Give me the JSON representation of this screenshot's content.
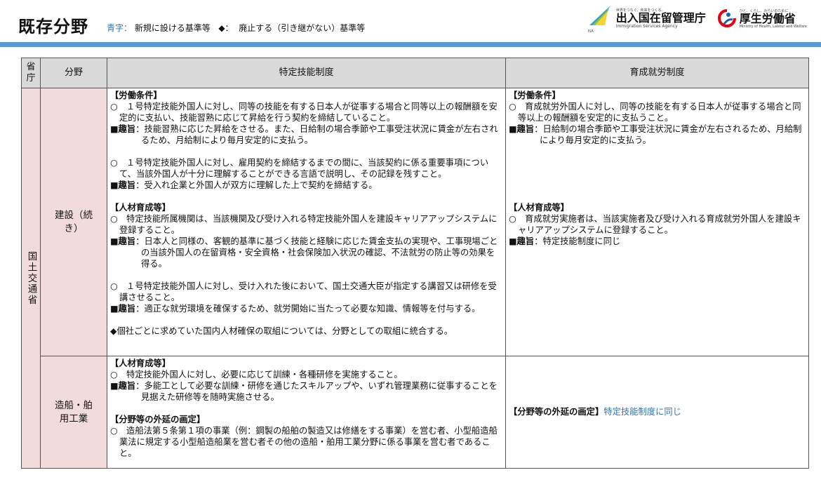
{
  "header": {
    "title": "既存分野",
    "legend_blue_label": "青字：",
    "legend_blue_text": "新規に設ける基準等",
    "legend_diamond_label": "◆：",
    "legend_diamond_text": "廃止する（引き継がない）基準等"
  },
  "logos": {
    "isa_tagline": "世界をつなぐ、未来をつくる。",
    "isa_name": "出入国在留管理庁",
    "isa_en": "Immigration Services Agency",
    "isa_abbr": "ISA",
    "mhlw_tagline": "ひと、くらし、みらいのために",
    "mhlw_name": "厚生労働省",
    "mhlw_en": "Ministry of Health, Labour and Welfare"
  },
  "table": {
    "headers": [
      "省庁",
      "分野",
      "特定技能制度",
      "育成就労制度"
    ],
    "ministry": "国土交通省",
    "rows": [
      {
        "field": "建設（続き）",
        "tokutei": [
          {
            "t": "h",
            "text": "【労働条件】"
          },
          {
            "t": "c",
            "text": "○　１号特定技能外国人に対し、同等の技能を有する日本人が従事する場合と同等以上の報酬額を安定的に支払い、技能習熟に応じて昇給を行う契約を締結していること。"
          },
          {
            "t": "s",
            "label": "■趣旨",
            "text": "：技能習熟に応じた昇給をさせる。また、日給制の場合季節や工事受注状況に賃金が左右されるため、月給制により毎月安定的に支払う。"
          },
          {
            "t": "g"
          },
          {
            "t": "c",
            "text": "○　１号特定技能外国人に対し、雇用契約を締結するまでの間に、当該契約に係る重要事項について、当該外国人が十分に理解することができる言語で説明し、その記録を残すこと。"
          },
          {
            "t": "s",
            "label": "■趣旨",
            "text": "：受入れ企業と外国人が双方に理解した上で契約を締結する。"
          },
          {
            "t": "g"
          },
          {
            "t": "h",
            "text": "【人材育成等】"
          },
          {
            "t": "c",
            "text": "○　特定技能所属機関は、当該機関及び受け入れる特定技能外国人を建設キャリアアップシステムに登録すること。"
          },
          {
            "t": "s",
            "label": "■趣旨",
            "text": "：日本人と同様の、客観的基準に基づく技能と経験に応じた賃金支払の実現や、工事現場ごとの当該外国人の在留資格・安全資格・社会保険加入状況の確認、不法就労の防止等の効果を得る。"
          },
          {
            "t": "g"
          },
          {
            "t": "c",
            "text": "○　１号特定技能外国人に対し、受け入れた後において、国土交通大臣が指定する講習又は研修を受講させること。"
          },
          {
            "t": "s",
            "label": "■趣旨",
            "text": "：適正な就労環境を確保するため、就労開始に当たって必要な知識、情報等を付与する。"
          },
          {
            "t": "g"
          },
          {
            "t": "p",
            "text": "◆個社ごとに求めていた国内人材確保の取組については、分野としての取組に統合する。"
          }
        ],
        "ikusei": [
          {
            "t": "h",
            "text": "【労働条件】"
          },
          {
            "t": "c",
            "text": "○　育成就労外国人に対し、同等の技能を有する日本人が従事する場合と同等以上の報酬額を安定的に支払うこと。"
          },
          {
            "t": "s",
            "label": "■趣旨",
            "text": "：日給制の場合季節や工事受注状況に賃金が左右されるため、月給制により毎月安定的に支払う。"
          },
          {
            "t": "g"
          },
          {
            "t": "g"
          },
          {
            "t": "g"
          },
          {
            "t": "g"
          },
          {
            "t": "g"
          },
          {
            "t": "h",
            "text": "【人材育成等】"
          },
          {
            "t": "c",
            "text": "○　育成就労実施者は、当該実施者及び受け入れる育成就労外国人を建設キャリアアップシステムに登録すること。"
          },
          {
            "t": "s",
            "label": "■趣旨",
            "text": "：特定技能制度に同じ"
          }
        ]
      },
      {
        "field": "造船・舶用工業",
        "tokutei": [
          {
            "t": "h",
            "text": "【人材育成等】"
          },
          {
            "t": "c",
            "text": "○　特定技能外国人に対し、必要に応じて訓練・各種研修を実施すること。"
          },
          {
            "t": "s",
            "label": "■趣旨",
            "text": "：多能工として必要な訓練・研修を通じたスキルアップや、いずれ管理業務に従事することを見据えた研修等を随時実施させる。"
          },
          {
            "t": "g"
          },
          {
            "t": "h",
            "text": "【分野等の外延の画定】"
          },
          {
            "t": "c",
            "text": "○　造船法第５条第１項の事業（例：鋼製の船舶の製造又は修繕をする事業）を営む者、小型船造船業法に規定する小型船造船業を営む者その他の造船・舶用工業分野に係る事業を営む者であること。"
          }
        ],
        "ikusei_label": "【分野等の外延の画定】",
        "ikusei_text": "特定技能制度に同じ"
      }
    ]
  }
}
